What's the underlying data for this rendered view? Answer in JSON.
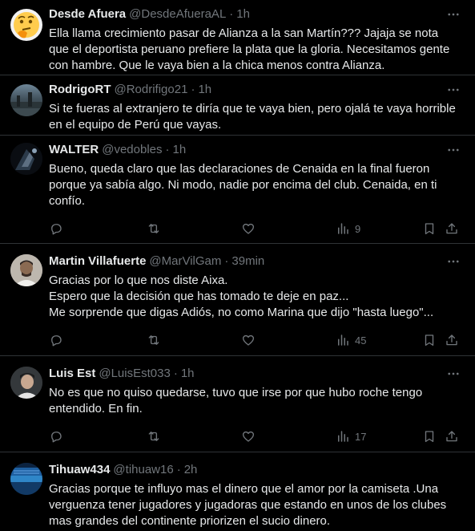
{
  "colors": {
    "background": "#000000",
    "text_primary": "#e7e9ea",
    "text_secondary": "#71767b",
    "divider": "#2f3336"
  },
  "icons": {
    "more": "more-horizontal-icon",
    "reply": "reply-icon",
    "retweet": "retweet-icon",
    "like": "heart-icon",
    "views": "bar-chart-icon",
    "bookmark": "bookmark-icon",
    "share": "share-icon"
  },
  "tweets": [
    {
      "name": "Desde Afuera",
      "handle": "@DesdeAfueraAL",
      "time": "1h",
      "text": "Ella llama crecimiento pasar de Alianza a la san Martín??? Jajaja se nota\nque el deportista peruano prefiere la plata que la gloria. Necesitamos gente\ncon hambre. Que le vaya bien a la chica menos contra Alianza.",
      "avatar": "thinking-face-emoji",
      "views": ""
    },
    {
      "name": "RodrigoRT",
      "handle": "@Rodrifigo21",
      "time": "1h",
      "text": "Si te fueras al extranjero te diría que te vaya bien, pero ojalá te vaya horrible\nen el equipo de Perú que vayas.",
      "avatar": "landscape-photo",
      "views": ""
    },
    {
      "name": "WALTER",
      "handle": "@vedobles",
      "time": "1h",
      "text": "Bueno, queda claro que las declaraciones de Cenaida en la final fueron\nporque ya sabía algo. Ni modo, nadie por encima del club. Cenaida, en ti\nconfío.",
      "avatar": "dark-photo",
      "views": "9"
    },
    {
      "name": "Martin Villafuerte",
      "handle": "@MarVilGam",
      "time": "39min",
      "text": "Gracias por lo que nos diste Aixa.\nEspero que la decisión que has tomado te deje en paz...\nMe sorprende que digas Adiós, no como Marina que dijo \"hasta luego\"...",
      "avatar": "portrait-photo",
      "views": "45"
    },
    {
      "name": "Luis Est",
      "handle": "@LuisEst033",
      "time": "1h",
      "text": "No es que no quiso quedarse, tuvo que irse por que hubo roche tengo\nentendido. En fin.",
      "avatar": "portrait-photo",
      "views": "17"
    },
    {
      "name": "Tihuaw434",
      "handle": "@tihuaw16",
      "time": "2h",
      "text": "Gracias porque te influyo mas el dinero que el amor por la camiseta .Una\nverguenza tener jugadores y jugadoras que estando en unos de los clubes\nmas grandes del continente priorizen el sucio dinero.",
      "avatar": "stadium-photo",
      "views": ""
    }
  ]
}
